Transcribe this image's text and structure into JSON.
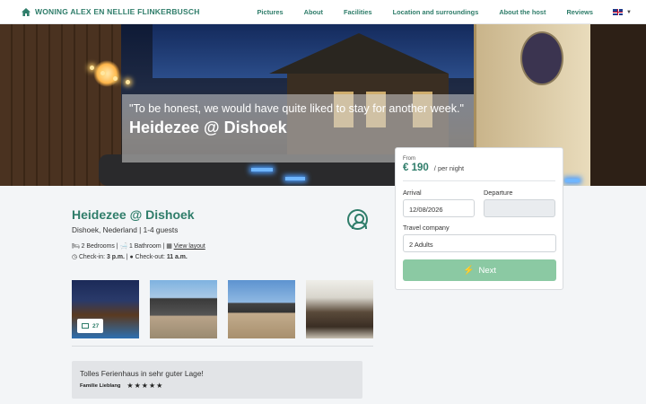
{
  "brand": {
    "name": "WONING ALEX EN NELLIE FLINKERBUSCH",
    "icon": "home-icon"
  },
  "nav": {
    "links": [
      "Pictures",
      "About",
      "Facilities",
      "Location and surroundings",
      "About the host",
      "Reviews"
    ],
    "language": "en-flag"
  },
  "hero": {
    "quote": "\"To be honest, we would have quite liked to stay for another week.\"",
    "title": "Heidezee @ Dishoek"
  },
  "booking": {
    "from_label": "From",
    "price": "€ 190",
    "per_night": "/ per night",
    "arrival_label": "Arrival",
    "arrival_value": "12/08/2026",
    "departure_label": "Departure",
    "departure_value": "",
    "company_label": "Travel company",
    "company_value": "2 Adults",
    "next_label": "Next"
  },
  "property": {
    "title": "Heidezee @ Dishoek",
    "location": "Dishoek, Nederland | 1-4 guests",
    "bedrooms": "2 Bedrooms",
    "bathroom": "1 Bathroom",
    "layout_link": "View layout",
    "checkin_label": "Check-in:",
    "checkin_time": "3 p.m.",
    "checkout_label": "Check-out:",
    "checkout_time": "11 a.m."
  },
  "gallery": {
    "photo_count": "27"
  },
  "review": {
    "text": "Tolles Ferienhaus in sehr guter Lage!",
    "author": "Familie Lieblang",
    "stars": "★★★★★",
    "rating": 5
  },
  "colors": {
    "accent": "#2f7d6a",
    "button": "#8bc9a3"
  }
}
